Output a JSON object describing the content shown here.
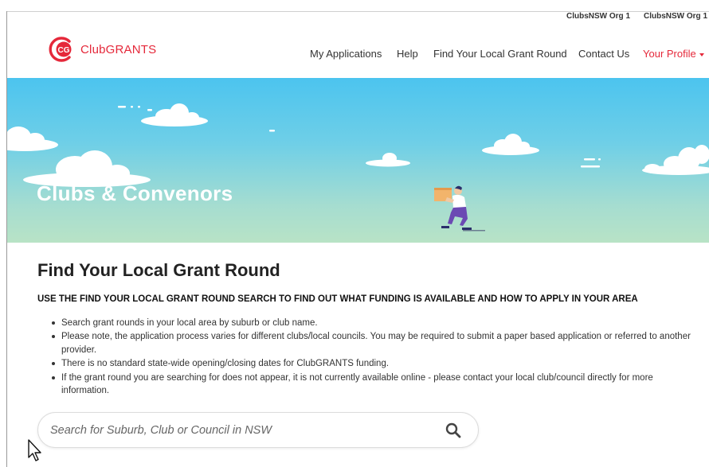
{
  "topbar": {
    "org_primary": "ClubsNSW Org 1",
    "org_secondary": "ClubsNSW Org 1"
  },
  "brand": {
    "logo_mark": "CG",
    "name": "ClubGRANTS",
    "accent_color": "#e5283a"
  },
  "nav": {
    "items": [
      "My Applications",
      "Help",
      "Find Your Local Grant Round",
      "Contact Us"
    ],
    "profile_label": "Your Profile"
  },
  "hero": {
    "title": "Clubs & Convenors"
  },
  "main": {
    "title": "Find Your Local Grant Round",
    "subheading": "USE THE FIND YOUR LOCAL GRANT ROUND SEARCH TO FIND OUT WHAT FUNDING IS AVAILABLE AND HOW TO APPLY IN YOUR AREA",
    "bullets": [
      "Search grant rounds in your local area by suburb or club name.",
      "Please note, the application process varies for different clubs/local councils. You may be required to submit a paper based application or referred to another provider.",
      "There is no standard state-wide opening/closing dates for ClubGRANTS funding.",
      "If the grant round you are searching for does not appear, it is not currently available online - please contact your local club/council directly for more information."
    ]
  },
  "search": {
    "placeholder": "Search for Suburb, Club or Council in NSW",
    "value": "",
    "icon": "search-icon"
  },
  "pointer": {
    "icon": "cursor-arrow-icon"
  }
}
